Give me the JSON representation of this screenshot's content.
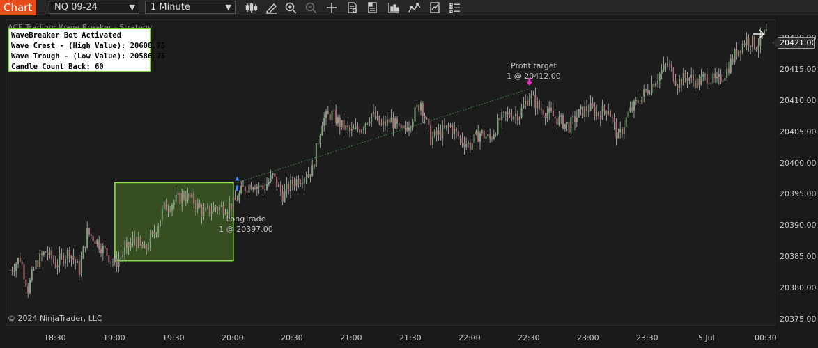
{
  "toolbar": {
    "chart_tab": "Chart",
    "instrument": "NQ 09-24",
    "interval": "1 Minute",
    "icons": [
      "bar-type-icon",
      "drawing-tool-icon",
      "zoom-in-icon",
      "zoom-out-icon",
      "crosshair-icon",
      "data-box-icon",
      "properties-icon",
      "chart-style-icon",
      "indicators-icon",
      "strategies-icon",
      "templates-icon"
    ]
  },
  "chart": {
    "strategy_title": "ACE Trading: Wave Breaker - Strategy",
    "info_box": {
      "line1": "WaveBreaker Bot Activated",
      "line2": "Wave Crest - (High Value): 20608.75",
      "line3": "Wave Trough - (Low Value): 20586.75",
      "line4": "Candle Count Back: 60"
    },
    "entry_label": {
      "name": "LongTrade",
      "detail": "1 @ 20397.00"
    },
    "exit_label": {
      "name": "Profit target",
      "detail": "1 @ 20412.00"
    },
    "copyright": "© 2024 NinjaTrader, LLC",
    "current_price": "20421.00",
    "colors": {
      "background": "#1c1c1c",
      "up_candle": "#7fa07a",
      "down_candle": "#b07077",
      "wick": "#cfcfcf",
      "box_fill": "#7bd233",
      "box_stroke": "#8fe34a",
      "entry_marker": "#3a8bff",
      "exit_marker": "#ff2ad4"
    }
  },
  "chart_data": {
    "type": "candlestick",
    "y_ticks": [
      "20421.00",
      "20420.00",
      "20415.00",
      "20410.00",
      "20405.00",
      "20400.00",
      "20395.00",
      "20390.00",
      "20385.00",
      "20380.00",
      "20375.00"
    ],
    "x_ticks": [
      "18:30",
      "19:00",
      "19:30",
      "20:00",
      "20:30",
      "21:00",
      "21:30",
      "22:00",
      "22:30",
      "23:00",
      "23:30",
      "5 Jul",
      "00:30"
    ],
    "ylim": [
      20374,
      20423
    ],
    "xlim": [
      "18:05",
      "00:35"
    ],
    "wave_box": {
      "start": "19:00",
      "end": "20:00",
      "high": 20397,
      "low": 20384.5
    },
    "entry": {
      "time": "20:02",
      "price": 20397.0
    },
    "exit": {
      "time": "22:30",
      "price": 20412.0
    },
    "path": [
      [
        "18:07",
        20383
      ],
      [
        "18:12",
        20385
      ],
      [
        "18:16",
        20380
      ],
      [
        "18:20",
        20384
      ],
      [
        "18:25",
        20386
      ],
      [
        "18:30",
        20384
      ],
      [
        "18:37",
        20386
      ],
      [
        "18:42",
        20383
      ],
      [
        "18:46",
        20389
      ],
      [
        "18:50",
        20388
      ],
      [
        "18:55",
        20386
      ],
      [
        "19:00",
        20384
      ],
      [
        "19:05",
        20386
      ],
      [
        "19:10",
        20388
      ],
      [
        "19:15",
        20386
      ],
      [
        "19:20",
        20389
      ],
      [
        "19:25",
        20393
      ],
      [
        "19:30",
        20394
      ],
      [
        "19:35",
        20395
      ],
      [
        "19:40",
        20394
      ],
      [
        "19:45",
        20392
      ],
      [
        "19:50",
        20393
      ],
      [
        "19:55",
        20393
      ],
      [
        "20:00",
        20393.5
      ],
      [
        "20:05",
        20396
      ],
      [
        "20:10",
        20397
      ],
      [
        "20:15",
        20396
      ],
      [
        "20:20",
        20398
      ],
      [
        "20:25",
        20395
      ],
      [
        "20:30",
        20397
      ],
      [
        "20:35",
        20398
      ],
      [
        "20:40",
        20399
      ],
      [
        "20:45",
        20407
      ],
      [
        "20:50",
        20408
      ],
      [
        "20:55",
        20406
      ],
      [
        "21:00",
        20405
      ],
      [
        "21:05",
        20406
      ],
      [
        "21:10",
        20408
      ],
      [
        "21:15",
        20406
      ],
      [
        "21:20",
        20407
      ],
      [
        "21:25",
        20405
      ],
      [
        "21:30",
        20407
      ],
      [
        "21:35",
        20410
      ],
      [
        "21:40",
        20404
      ],
      [
        "21:45",
        20405
      ],
      [
        "21:50",
        20406
      ],
      [
        "21:55",
        20404
      ],
      [
        "22:00",
        20403
      ],
      [
        "22:05",
        20405
      ],
      [
        "22:10",
        20404
      ],
      [
        "22:15",
        20407
      ],
      [
        "22:20",
        20408
      ],
      [
        "22:25",
        20408
      ],
      [
        "22:30",
        20411
      ],
      [
        "22:35",
        20409
      ],
      [
        "22:40",
        20408
      ],
      [
        "22:45",
        20407
      ],
      [
        "22:50",
        20406
      ],
      [
        "22:55",
        20408
      ],
      [
        "23:00",
        20409
      ],
      [
        "23:05",
        20408
      ],
      [
        "23:10",
        20409
      ],
      [
        "23:15",
        20404
      ],
      [
        "23:20",
        20408
      ],
      [
        "23:25",
        20410
      ],
      [
        "23:30",
        20412
      ],
      [
        "23:35",
        20414
      ],
      [
        "23:40",
        20416
      ],
      [
        "23:45",
        20413
      ],
      [
        "23:50",
        20414
      ],
      [
        "23:55",
        20413
      ],
      [
        "5 Jul",
        20414
      ],
      [
        "00:05",
        20413
      ],
      [
        "00:10",
        20415
      ],
      [
        "00:15",
        20418
      ],
      [
        "00:20",
        20420
      ],
      [
        "00:25",
        20419
      ],
      [
        "00:30",
        20421
      ]
    ]
  }
}
